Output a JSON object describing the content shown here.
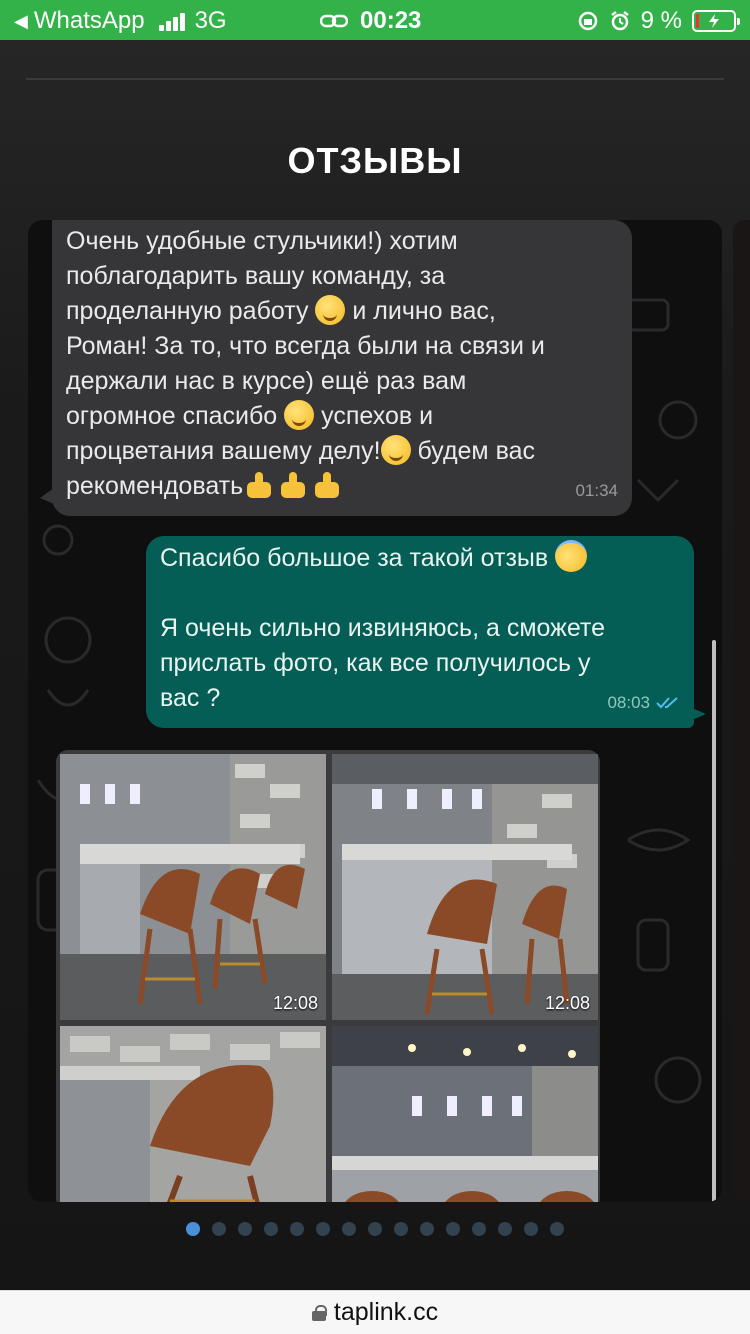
{
  "status_bar": {
    "back_app": "WhatsApp",
    "network": "3G",
    "time": "00:23",
    "battery": "9 %",
    "battery_level": 0.09,
    "background": "#34b24a"
  },
  "section": {
    "title": "ОТЗЫВЫ"
  },
  "messages": {
    "incoming": {
      "lines": [
        "Очень удобные стульчики!) хотим",
        "поблагодарить вашу команду, за",
        "проделанную работу",
        "и лично вас,",
        "Роман! За то, что всегда были на связи и",
        "держали нас в курсе) ещё раз вам",
        "огромное спасибо",
        "успехов и",
        "процветания вашему делу!",
        "будем вас",
        "рекомендовать"
      ],
      "time": "01:34"
    },
    "outgoing": {
      "line1": "Спасибо большое за такой отзыв",
      "lines": [
        "Я очень сильно извиняюсь, а сможете",
        "прислать фото, как все получилось у",
        "вас ?"
      ],
      "time": "08:03"
    }
  },
  "photos": [
    {
      "time": "12:08"
    },
    {
      "time": "12:08"
    }
  ],
  "carousel": {
    "count": 15,
    "active": 0
  },
  "browser": {
    "url": "taplink.cc"
  },
  "colors": {
    "incoming_bubble": "#363638",
    "outgoing_bubble": "#055e55",
    "dot_active": "#4a90d9",
    "dot": "#33424f"
  }
}
